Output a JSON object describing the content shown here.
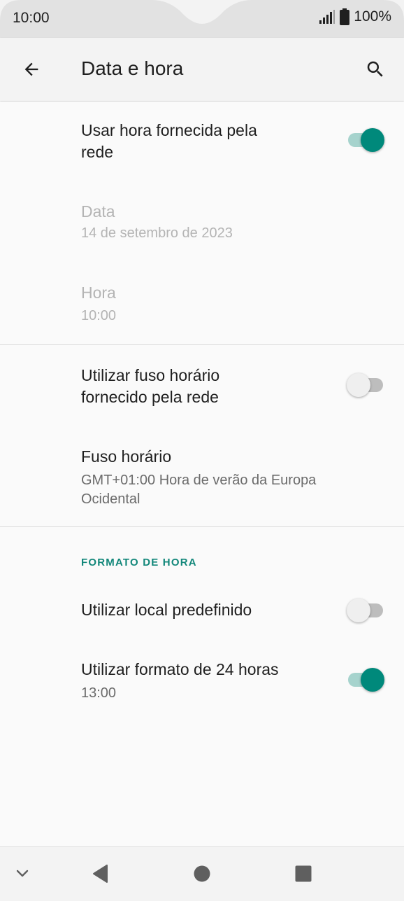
{
  "status_bar": {
    "time": "10:00",
    "battery": "100%",
    "icons": [
      "signal-icon",
      "battery-icon"
    ]
  },
  "app_bar": {
    "title": "Data e hora",
    "back_icon": "back-arrow-icon",
    "search_icon": "search-icon"
  },
  "settings": {
    "network_time": {
      "title_line1": "Usar hora fornecida pela",
      "title_line2": "rede",
      "enabled": true
    },
    "date": {
      "title": "Data",
      "value": "14 de setembro de 2023"
    },
    "time": {
      "title": "Hora",
      "value": "10:00"
    },
    "network_timezone": {
      "title_line1": "Utilizar fuso horário",
      "title_line2": "fornecido pela rede",
      "enabled": false
    },
    "timezone": {
      "title": "Fuso horário",
      "value_line1": "GMT+01:00 Hora de verão da Europa",
      "value_line2": "Ocidental"
    },
    "time_format_header": "FORMATO DE HORA",
    "use_locale_default": {
      "title": "Utilizar local predefinido",
      "enabled": false
    },
    "use_24_hour": {
      "title": "Utilizar formato de 24 horas",
      "example": "13:00",
      "enabled": true
    }
  },
  "nav_bar": {
    "buttons": [
      "chevron-down-icon",
      "back-triangle-icon",
      "home-circle-icon",
      "recents-square-icon"
    ]
  },
  "colors": {
    "accent": "#00897b",
    "accent_track": "#a6d3cd",
    "section_header": "#12877a",
    "background": "#fafafa",
    "bar_background": "#f3f3f3"
  }
}
